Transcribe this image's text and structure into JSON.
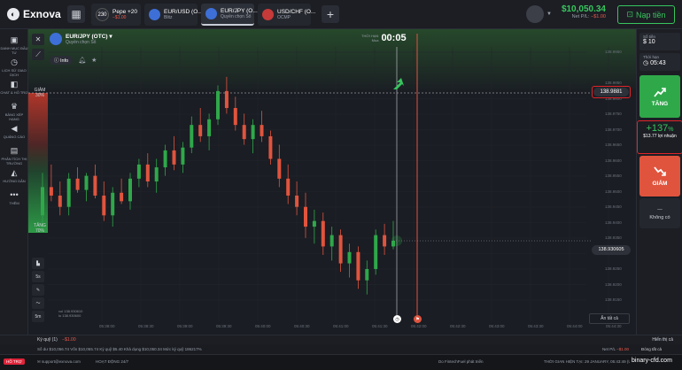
{
  "brand": "Exnova",
  "tabs": [
    {
      "icon_label": "230",
      "title": "Pepe +20",
      "sub": "−$1.00",
      "sub_neg": true,
      "close": "✕",
      "active": false
    },
    {
      "title": "EUR/USD (O...",
      "sub": "Blitz",
      "sub_neg": false,
      "close": "✕",
      "active": false
    },
    {
      "title": "EUR/JPY (O...",
      "sub": "Quyền chọn Số",
      "sub_neg": false,
      "close": "✕",
      "active": true
    },
    {
      "title": "USD/CHF (O...",
      "sub": "OCMP",
      "sub_neg": false,
      "close": "✕",
      "active": false
    }
  ],
  "account": {
    "balance": "$10,050.34",
    "net_pl_label": "Net P/L",
    "net_pl_value": "−$1.00",
    "deposit_label": "Nạp tiền"
  },
  "nav": [
    {
      "label": "DANH MỤC ĐẦU TƯ",
      "icon": "briefcase-icon"
    },
    {
      "label": "LỊCH SỬ GIAO DỊCH",
      "icon": "history-icon"
    },
    {
      "label": "CHAT & HỖ TRỢ",
      "icon": "chat-icon"
    },
    {
      "label": "BẢNG XẾP HẠNG",
      "icon": "trophy-icon"
    },
    {
      "label": "QUẢNG CÁO",
      "icon": "megaphone-icon"
    },
    {
      "label": "PHÂN TÍCH THỊ TRƯỜNG",
      "icon": "analysis-icon"
    },
    {
      "label": "HƯỚNG DẪN",
      "icon": "education-icon"
    },
    {
      "label": "THÊM",
      "icon": "more-icon"
    }
  ],
  "chart": {
    "asset": "EUR/JPY (OTC)",
    "asset_type": "Quyền chọn Số",
    "info_label": "Info",
    "timer_label_1": "THỜI HẠN",
    "timer_label_2": "Mua",
    "timer_value": "00:05",
    "target_price": "138.9881",
    "current_price": "138.930605",
    "price_levels": [
      "138.9950",
      "138.9881",
      "138.9850",
      "138.9800",
      "138.9750",
      "138.9700",
      "138.9650",
      "138.9600",
      "138.9550",
      "138.9500",
      "138.9450",
      "138.9400",
      "138.9350",
      "138.9300",
      "138.9250",
      "138.9200",
      "138.9150"
    ],
    "down_label": "GIẢM",
    "down_pct": "30%",
    "up_label": "TĂNG",
    "up_pct": "70%",
    "time_ticks": [
      "05:38:00",
      "05:38:30",
      "05:39:00",
      "05:39:30",
      "05:40:00",
      "05:40:30",
      "05:41:00",
      "05:41:30",
      "05:42:00",
      "05:42:30",
      "05:43:00",
      "05:43:30",
      "05:44:00",
      "05:44:30"
    ],
    "mini_info_1": "vol 138.930610",
    "mini_info_2": "lo 138.930600",
    "close_all_label": "Ấn tất cả",
    "draw_tools": [
      "▙",
      "5s",
      "✎",
      "〜",
      "5m"
    ]
  },
  "chart_data": {
    "type": "candlestick",
    "candles": [
      [
        138.94,
        138.955,
        138.935,
        138.95
      ],
      [
        138.95,
        138.958,
        138.945,
        138.947
      ],
      [
        138.947,
        138.952,
        138.94,
        138.943
      ],
      [
        138.943,
        138.955,
        138.94,
        138.953
      ],
      [
        138.953,
        138.957,
        138.948,
        138.949
      ],
      [
        138.949,
        138.955,
        138.945,
        138.954
      ],
      [
        138.954,
        138.958,
        138.946,
        138.947
      ],
      [
        138.947,
        138.952,
        138.938,
        138.94
      ],
      [
        138.94,
        138.95,
        138.936,
        138.948
      ],
      [
        138.948,
        138.953,
        138.944,
        138.945
      ],
      [
        138.945,
        138.955,
        138.942,
        138.953
      ],
      [
        138.953,
        138.96,
        138.95,
        138.958
      ],
      [
        138.958,
        138.962,
        138.95,
        138.952
      ],
      [
        138.952,
        138.96,
        138.948,
        138.957
      ],
      [
        138.957,
        138.965,
        138.954,
        138.963
      ],
      [
        138.963,
        138.968,
        138.956,
        138.958
      ],
      [
        138.958,
        138.966,
        138.955,
        138.964
      ],
      [
        138.964,
        138.975,
        138.962,
        138.972
      ],
      [
        138.972,
        138.978,
        138.966,
        138.968
      ],
      [
        138.968,
        138.976,
        138.963,
        138.974
      ],
      [
        138.974,
        138.986,
        138.972,
        138.984
      ],
      [
        138.984,
        138.989,
        138.976,
        138.978
      ],
      [
        138.978,
        138.982,
        138.97,
        138.972
      ],
      [
        138.972,
        138.976,
        138.965,
        138.967
      ],
      [
        138.967,
        138.974,
        138.962,
        138.972
      ],
      [
        138.972,
        138.977,
        138.966,
        138.968
      ],
      [
        138.968,
        138.97,
        138.958,
        138.96
      ],
      [
        138.96,
        138.965,
        138.95,
        138.953
      ],
      [
        138.953,
        138.958,
        138.944,
        138.947
      ],
      [
        138.947,
        138.952,
        138.94,
        138.943
      ],
      [
        138.943,
        138.948,
        138.932,
        138.936
      ],
      [
        138.936,
        138.942,
        138.93,
        138.938
      ],
      [
        138.938,
        138.941,
        138.926,
        138.929
      ],
      [
        138.929,
        138.936,
        138.924,
        138.933
      ],
      [
        138.933,
        138.935,
        138.92,
        138.923
      ],
      [
        138.923,
        138.93,
        138.918,
        138.927
      ],
      [
        138.927,
        138.929,
        138.914,
        138.917
      ],
      [
        138.917,
        138.924,
        138.912,
        138.921
      ],
      [
        138.921,
        138.935,
        138.919,
        138.933
      ],
      [
        138.933,
        138.937,
        138.926,
        138.929
      ],
      [
        138.929,
        138.938,
        138.928,
        138.931
      ]
    ],
    "ylim": [
      138.905,
      138.999
    ]
  },
  "right": {
    "amount_label": "Số tiền",
    "amount_value": "10",
    "time_label": "Thời hạn",
    "time_value": "05:43",
    "up_label": "TĂNG",
    "payout_pct": "+137",
    "payout_pct_suffix": "%",
    "profit_text": "$13.77 lợi nhuận",
    "down_label": "GIẢM",
    "none_value": "—",
    "none_label": "Không có"
  },
  "bottom": {
    "bar1_label": "Ký quỹ (1)",
    "bar1_value": "−$1.00",
    "bar1_right": "Hiển thị cả",
    "bar2": "Số dư $10,056.74    Vốn $10,055.74    Ký quỹ $5.40    Khả dụng $10,050.34    Mức ký quỹ 186217%",
    "bar2_right_label": "Net P/L",
    "bar2_right_value": "−$1.00",
    "bar2_close": "Đóng tất cả",
    "support_label": "HỖ TRỢ",
    "support_email": "support@exnova.com",
    "support_hours": "HOẠT ĐỘNG 24/7",
    "powered": "Do  FintechFuel phát triển",
    "current_time": "THỜI GIAN HIỆN TẠI:  29 JANUARY, 05:43:49 (UTC+",
    "watermark": "binary-cfd.com"
  },
  "colors": {
    "up": "#2fa84a",
    "down": "#e0543e",
    "accent_red": "#e0242a",
    "green_text": "#38c55e"
  }
}
